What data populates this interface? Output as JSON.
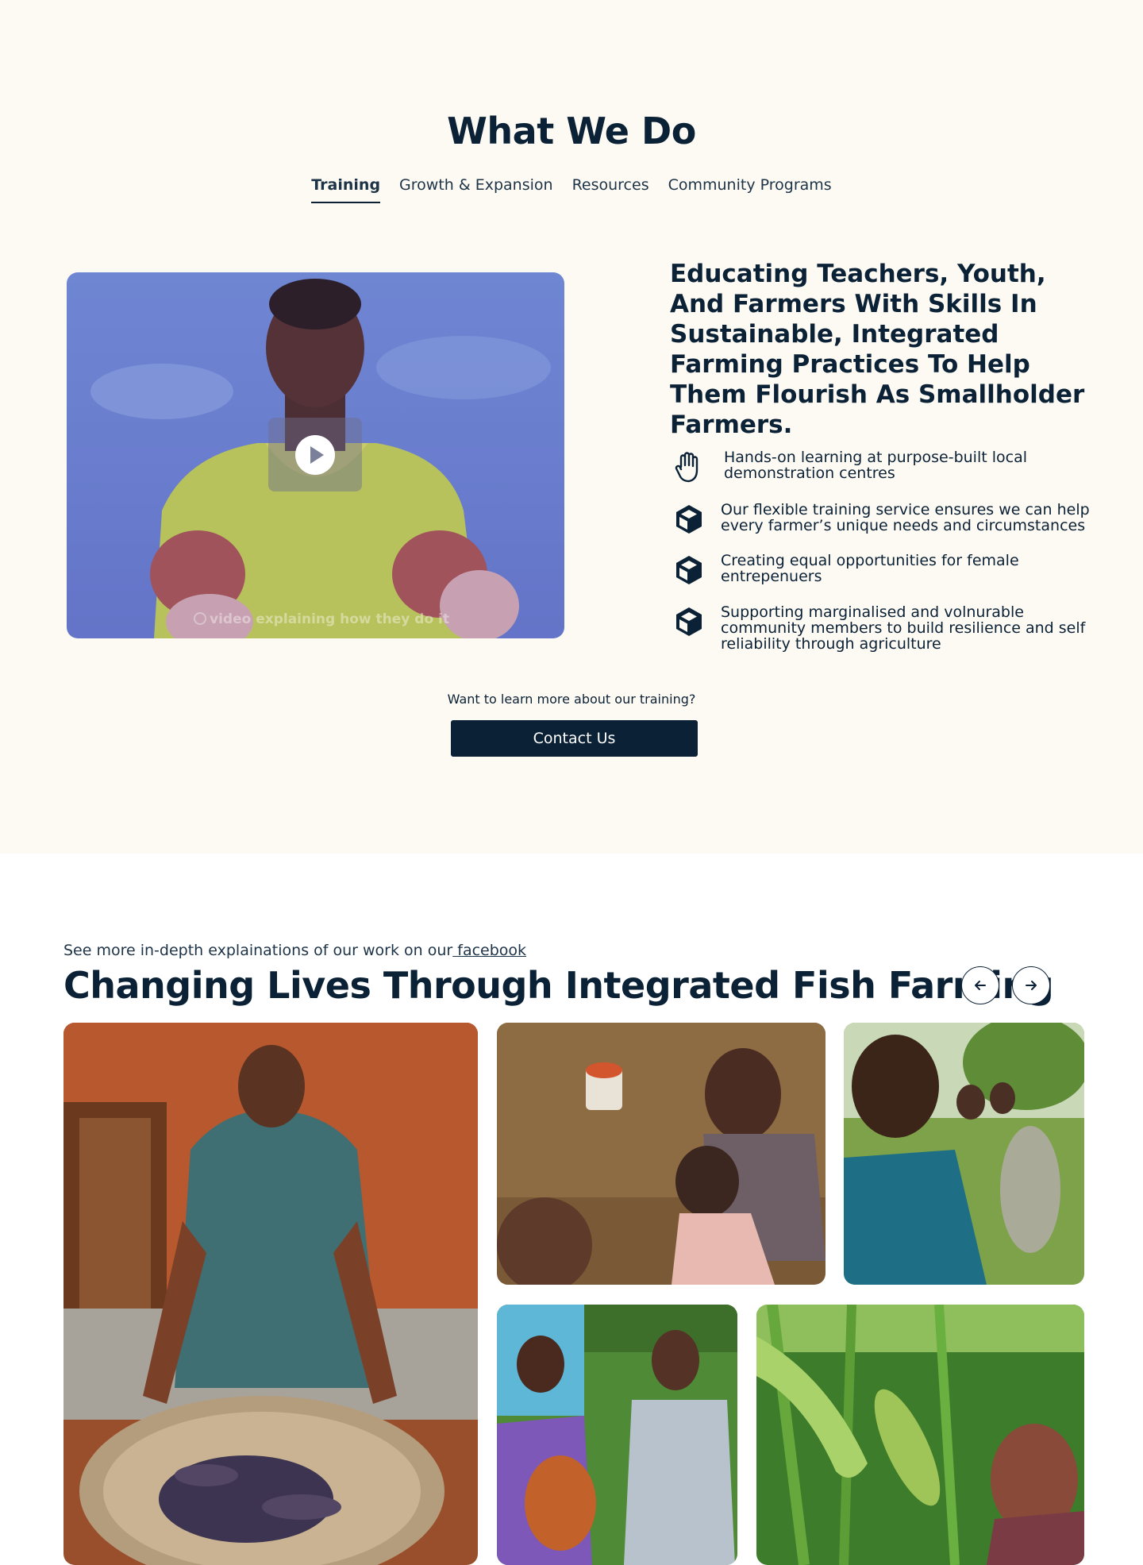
{
  "section_what_we_do": {
    "title": "What We Do",
    "tabs": [
      {
        "label": "Training",
        "active": true
      },
      {
        "label": "Growth & Expansion",
        "active": false
      },
      {
        "label": "Resources",
        "active": false
      },
      {
        "label": "Community Programs",
        "active": false
      }
    ],
    "video": {
      "caption": "video explaining how they do it",
      "play_icon": "play-icon"
    },
    "headline": "Educating Teachers, Youth,  And Farmers With Skills In Sustainable, Integrated Farming Practices To Help Them Flourish As Smallholder Farmers.",
    "features": [
      {
        "icon": "hand-icon",
        "text": "Hands-on learning at purpose-built local demonstration centres"
      },
      {
        "icon": "box-icon",
        "text": "Our flexible training service ensures we can help every farmer’s unique needs and circumstances"
      },
      {
        "icon": "box-icon",
        "text": "Creating equal opportunities for female entrepenuers"
      },
      {
        "icon": "box-icon",
        "text": "Supporting marginalised and volnurable community members to build resilience and self reliability through agriculture"
      }
    ],
    "cta_prompt": "Want to learn more about our training?",
    "cta_button": "Contact Us"
  },
  "section_changing_lives": {
    "see_more_prefix": "See more in-depth explainations of our work on our",
    "see_more_link": " facebook",
    "title": "Changing Lives Through Integrated Fish Farming",
    "prev_icon": "arrow-left-icon",
    "next_icon": "arrow-right-icon"
  },
  "colors": {
    "navy": "#0b2136",
    "cream_background": "#fdfaf3",
    "white": "#ffffff"
  }
}
